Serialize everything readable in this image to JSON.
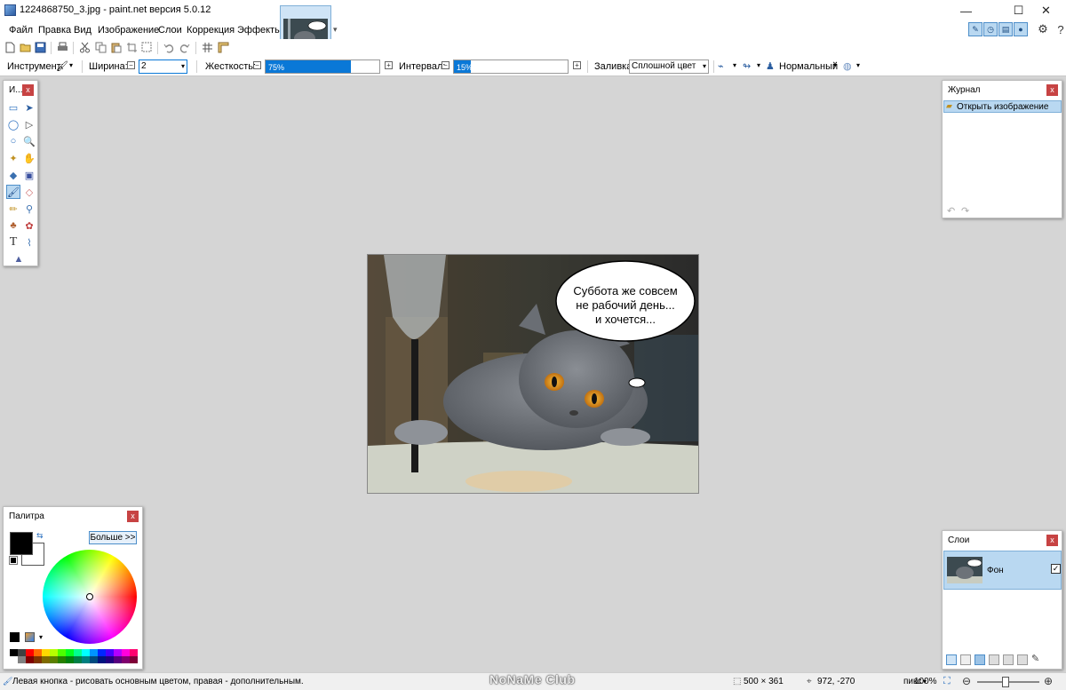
{
  "window": {
    "title": "1224868750_3.jpg - paint.net версия 5.0.12",
    "minimize": "—",
    "maximize": "☐",
    "close": "✕"
  },
  "menu": {
    "items": [
      "Файл",
      "Правка",
      "Вид",
      "Изображение",
      "Слои",
      "Коррекция",
      "Эффекты"
    ]
  },
  "options": {
    "tool_label": "Инструмент:",
    "width_label": "Ширина:",
    "width_value": "2",
    "hardness_label": "Жесткость:",
    "hardness_value": "75%",
    "hardness_fraction": 0.75,
    "interval_label": "Интервал:",
    "interval_value": "15%",
    "interval_fraction": 0.15,
    "fill_label": "Заливка:",
    "fill_value": "Сплошной цвет",
    "blend_value": "Нормальный"
  },
  "canvas": {
    "speech_lines": [
      "Суббота же совсем",
      "не рабочий день...",
      "и хочется..."
    ]
  },
  "tools_panel": {
    "title": "И...",
    "close": "x"
  },
  "history_panel": {
    "title": "Журнал",
    "close": "x",
    "items": [
      "Открыть изображение"
    ]
  },
  "palette_panel": {
    "title": "Палитра",
    "close": "x",
    "more_button": "Больше >>",
    "primary_color": "#000000",
    "secondary_color": "#ffffff",
    "swatches": [
      "#000000",
      "#404040",
      "#ff0000",
      "#ff6a00",
      "#ffd800",
      "#b6ff00",
      "#4cff00",
      "#00ff21",
      "#00ff90",
      "#00ffff",
      "#0094ff",
      "#0026ff",
      "#4800ff",
      "#b200ff",
      "#ff00dc",
      "#ff006e",
      "#ffffff",
      "#808080",
      "#7f0000",
      "#7f3300",
      "#7f6a00",
      "#5b7f00",
      "#267f00",
      "#007f0e",
      "#007f46",
      "#007f7f",
      "#004a7f",
      "#00137f",
      "#21007f",
      "#57007f",
      "#7f006e",
      "#7f0037"
    ]
  },
  "layers_panel": {
    "title": "Слои",
    "close": "x",
    "layers": [
      {
        "name": "Фон",
        "checked": "✓"
      }
    ]
  },
  "status": {
    "hint": "Левая кнопка - рисовать основным цветом, правая - дополнительным.",
    "image_size": "500 × 361",
    "cursor_pos": "972, -270",
    "unit": "пикс",
    "zoom": "100%"
  },
  "watermark": "NoNaMe Club"
}
